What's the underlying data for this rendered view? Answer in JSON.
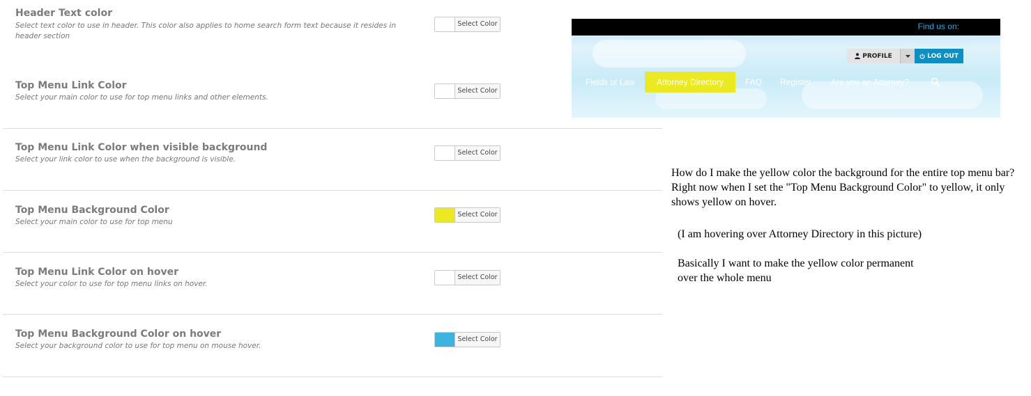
{
  "settings": [
    {
      "title": "Header Text color",
      "desc": "Select text color to use in header. This color also applies to home search form text because it resides in header section",
      "swatch": "#ffffff",
      "button": "Select Color"
    },
    {
      "title": "Top Menu Link Color",
      "desc": "Select your main color to use for top menu links and other elements.",
      "swatch": "#ffffff",
      "button": "Select Color"
    },
    {
      "title": "Top Menu Link Color when visible background",
      "desc": "Select your link color to use when the background is visible.",
      "swatch": "#ffffff",
      "button": "Select Color"
    },
    {
      "title": "Top Menu Background Color",
      "desc": "Select your main color to use for top menu",
      "swatch": "#ebe922",
      "button": "Select Color"
    },
    {
      "title": "Top Menu Link Color on hover",
      "desc": "Select your color to use for top menu links on hover.",
      "swatch": "#ffffff",
      "button": "Select Color"
    },
    {
      "title": "Top Menu Background Color on hover",
      "desc": "Select your background color to use for top menu on mouse hover.",
      "swatch": "#3cb4de",
      "button": "Select Color"
    }
  ],
  "site": {
    "find_us": "Find us on:",
    "profile": "PROFILE",
    "logout": "LOG OUT",
    "nav": [
      "Fields of Law",
      "Attorney Directory",
      "FAQ",
      "Register",
      "Are you an Attorney?"
    ],
    "active_color": "#ebe922",
    "logout_color": "#0e8fc3"
  },
  "question": {
    "main": "How do I make the yellow color the background for the entire top menu bar? Right now when I set the \"Top Menu Background Color\" to yellow, it only shows yellow on hover.",
    "note": "(I am hovering over Attorney Directory in this picture)",
    "basically_1": "Basically I want to make the yellow color permanent",
    "basically_2": "over the whole menu"
  }
}
